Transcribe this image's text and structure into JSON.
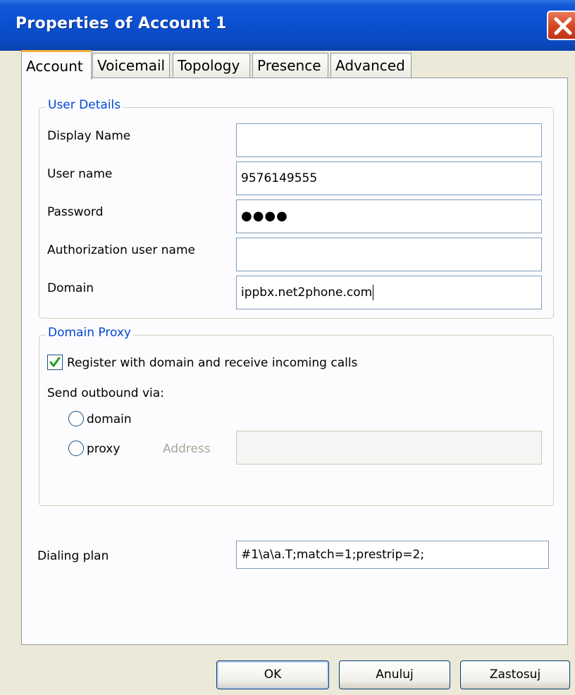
{
  "window": {
    "title": "Properties of Account 1"
  },
  "tabs": [
    {
      "label": "Account",
      "active": true
    },
    {
      "label": "Voicemail"
    },
    {
      "label": "Topology"
    },
    {
      "label": "Presence"
    },
    {
      "label": "Advanced"
    }
  ],
  "user_details": {
    "legend": "User Details",
    "display_name": {
      "label": "Display Name",
      "value": ""
    },
    "user_name": {
      "label": "User name",
      "value": "9576149555"
    },
    "password": {
      "label": "Password",
      "value": "●●●●"
    },
    "auth_user_name": {
      "label": "Authorization user name",
      "value": ""
    },
    "domain": {
      "label": "Domain",
      "value": "ippbx.net2phone.com"
    }
  },
  "domain_proxy": {
    "legend": "Domain Proxy",
    "register_label": "Register with domain and receive incoming calls",
    "register_checked": true,
    "send_outbound_label": "Send outbound via:",
    "option_domain": "domain",
    "option_proxy": "proxy",
    "address_label": "Address",
    "address_value": ""
  },
  "dialing_plan": {
    "label": "Dialing plan",
    "value": "#1\\a\\a.T;match=1;prestrip=2;"
  },
  "buttons": {
    "ok": "OK",
    "cancel": "Anuluj",
    "apply": "Zastosuj"
  },
  "colors": {
    "titlebar": "#0a4fd0",
    "legend": "#0046d5",
    "tab_highlight": "#f6b23a",
    "checkmark": "#21a121"
  },
  "icons": {
    "close": "close-icon"
  }
}
